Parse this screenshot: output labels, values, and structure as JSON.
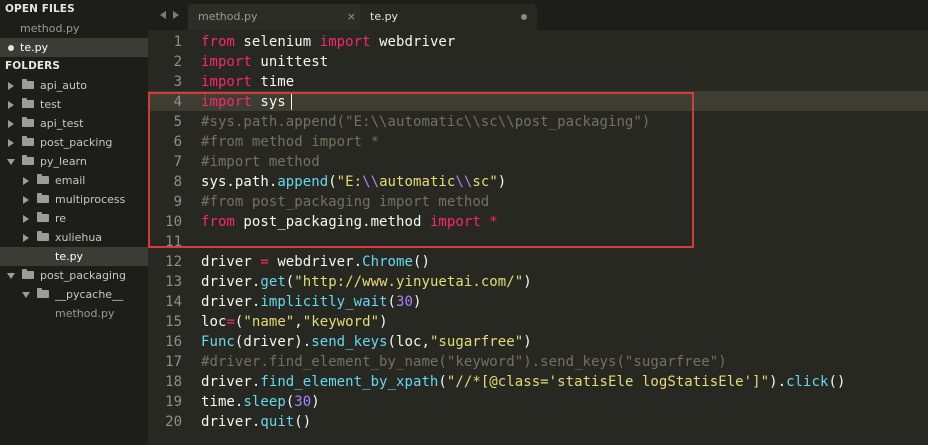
{
  "sidebar": {
    "open_files_header": "OPEN FILES",
    "open_files": [
      {
        "label": "method.py"
      },
      {
        "label": "te.py"
      }
    ],
    "folders_header": "FOLDERS",
    "folders": [
      {
        "label": "api_auto"
      },
      {
        "label": "test"
      },
      {
        "label": "api_test"
      },
      {
        "label": "post_packing"
      },
      {
        "label": "py_learn"
      },
      {
        "label": "email"
      },
      {
        "label": "multiprocess"
      },
      {
        "label": "re"
      },
      {
        "label": "xuliehua"
      },
      {
        "label": "te.py"
      },
      {
        "label": "post_packaging"
      },
      {
        "label": "__pycache__"
      },
      {
        "label": "method.py"
      }
    ]
  },
  "tabs": [
    {
      "label": "method.py",
      "close": "×"
    },
    {
      "label": "te.py"
    }
  ],
  "editor": {
    "line_numbers": [
      "1",
      "2",
      "3",
      "4",
      "5",
      "6",
      "7",
      "8",
      "9",
      "10",
      "11",
      "12",
      "13",
      "14",
      "15",
      "16",
      "17",
      "18",
      "19",
      "20"
    ],
    "active_line": 4,
    "lines": [
      [
        {
          "t": "from",
          "c": "kw"
        },
        {
          "t": " selenium ",
          "c": ""
        },
        {
          "t": "import",
          "c": "kw"
        },
        {
          "t": " webdriver",
          "c": ""
        }
      ],
      [
        {
          "t": "import",
          "c": "kw"
        },
        {
          "t": " unittest",
          "c": ""
        }
      ],
      [
        {
          "t": "import",
          "c": "kw"
        },
        {
          "t": " time",
          "c": ""
        }
      ],
      [
        {
          "t": "import",
          "c": "kw"
        },
        {
          "t": " sys",
          "c": ""
        }
      ],
      [
        {
          "t": "#sys.path.append(\"E:\\\\automatic\\\\sc\\\\post_packaging\")",
          "c": "cm"
        }
      ],
      [
        {
          "t": "#from method import *",
          "c": "cm"
        }
      ],
      [
        {
          "t": "#import method",
          "c": "cm"
        }
      ],
      [
        {
          "t": "sys.path.",
          "c": ""
        },
        {
          "t": "append",
          "c": "fn"
        },
        {
          "t": "(",
          "c": ""
        },
        {
          "t": "\"E:",
          "c": "str"
        },
        {
          "t": "\\\\",
          "c": "esc"
        },
        {
          "t": "automatic",
          "c": "str"
        },
        {
          "t": "\\\\",
          "c": "esc"
        },
        {
          "t": "sc\"",
          "c": "str"
        },
        {
          "t": ")",
          "c": ""
        }
      ],
      [
        {
          "t": "#from post_packaging import method",
          "c": "cm"
        }
      ],
      [
        {
          "t": "from",
          "c": "kw"
        },
        {
          "t": " post_packaging.method ",
          "c": ""
        },
        {
          "t": "import",
          "c": "kw"
        },
        {
          "t": " ",
          "c": ""
        },
        {
          "t": "*",
          "c": "kw"
        }
      ],
      [
        {
          "t": "",
          "c": ""
        }
      ],
      [
        {
          "t": "driver ",
          "c": ""
        },
        {
          "t": "=",
          "c": "kw"
        },
        {
          "t": " webdriver.",
          "c": ""
        },
        {
          "t": "Chrome",
          "c": "fn"
        },
        {
          "t": "()",
          "c": ""
        }
      ],
      [
        {
          "t": "driver.",
          "c": ""
        },
        {
          "t": "get",
          "c": "fn"
        },
        {
          "t": "(",
          "c": ""
        },
        {
          "t": "\"http://www.yinyuetai.com/\"",
          "c": "str"
        },
        {
          "t": ")",
          "c": ""
        }
      ],
      [
        {
          "t": "driver.",
          "c": ""
        },
        {
          "t": "implicitly_wait",
          "c": "fn"
        },
        {
          "t": "(",
          "c": ""
        },
        {
          "t": "30",
          "c": "num"
        },
        {
          "t": ")",
          "c": ""
        }
      ],
      [
        {
          "t": "loc",
          "c": ""
        },
        {
          "t": "=",
          "c": "kw"
        },
        {
          "t": "(",
          "c": ""
        },
        {
          "t": "\"name\"",
          "c": "str"
        },
        {
          "t": ",",
          "c": ""
        },
        {
          "t": "\"keyword\"",
          "c": "str"
        },
        {
          "t": ")",
          "c": ""
        }
      ],
      [
        {
          "t": "Func",
          "c": "fn"
        },
        {
          "t": "(driver).",
          "c": ""
        },
        {
          "t": "send_keys",
          "c": "fn"
        },
        {
          "t": "(loc,",
          "c": ""
        },
        {
          "t": "\"sugarfree\"",
          "c": "str"
        },
        {
          "t": ")",
          "c": ""
        }
      ],
      [
        {
          "t": "#driver.find_element_by_name(\"keyword\").send_keys(\"sugarfree\")",
          "c": "cm"
        }
      ],
      [
        {
          "t": "driver.",
          "c": ""
        },
        {
          "t": "find_element_by_xpath",
          "c": "fn"
        },
        {
          "t": "(",
          "c": ""
        },
        {
          "t": "\"//*[@class='statisEle logStatisEle']\"",
          "c": "str"
        },
        {
          "t": ").",
          "c": ""
        },
        {
          "t": "click",
          "c": "fn"
        },
        {
          "t": "()",
          "c": ""
        }
      ],
      [
        {
          "t": "time.",
          "c": ""
        },
        {
          "t": "sleep",
          "c": "fn"
        },
        {
          "t": "(",
          "c": ""
        },
        {
          "t": "30",
          "c": "num"
        },
        {
          "t": ")",
          "c": ""
        }
      ],
      [
        {
          "t": "driver.",
          "c": ""
        },
        {
          "t": "quit",
          "c": "fn"
        },
        {
          "t": "()",
          "c": ""
        }
      ]
    ]
  },
  "theme": {
    "background": "#272822",
    "keyword": "#f92672",
    "function": "#66d9ef",
    "string": "#e6db74",
    "number": "#ae81ff",
    "comment": "#75715e",
    "annotation_box": "#d63a3a"
  }
}
